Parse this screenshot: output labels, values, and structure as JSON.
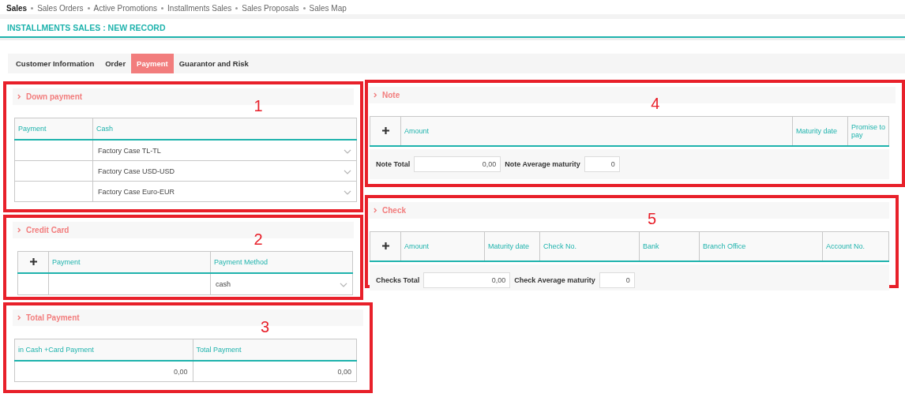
{
  "nav": [
    {
      "label": "Sales",
      "selected": true
    },
    {
      "label": "Sales Orders",
      "selected": false
    },
    {
      "label": "Active Promotions",
      "selected": false
    },
    {
      "label": "Installments Sales",
      "selected": false
    },
    {
      "label": "Sales Proposals",
      "selected": false
    },
    {
      "label": "Sales Map",
      "selected": false
    }
  ],
  "title": "INSTALLMENTS SALES : NEW RECORD",
  "tabs": [
    {
      "label": "Customer Information",
      "selected": false
    },
    {
      "label": "Order",
      "selected": false
    },
    {
      "label": "Payment",
      "selected": true
    },
    {
      "label": "Guarantor and Risk",
      "selected": false
    }
  ],
  "down_payment": {
    "marker": "1",
    "title": "Down payment",
    "columns": [
      "Payment",
      "Cash"
    ],
    "rows": [
      "Factory Case TL-TL",
      "Factory Case USD-USD",
      "Factory Case Euro-EUR"
    ]
  },
  "credit_card": {
    "marker": "2",
    "title": "Credit Card",
    "columns": [
      "Payment",
      "Payment Method"
    ],
    "rows": [
      "cash"
    ]
  },
  "total_payment": {
    "marker": "3",
    "title": "Total Payment",
    "columns": [
      "in Cash +Card Payment",
      "Total Payment"
    ],
    "values": [
      "0,00",
      "0,00"
    ]
  },
  "note": {
    "marker": "4",
    "title": "Note",
    "columns": [
      "Amount",
      "Maturity date",
      "Promise to pay"
    ],
    "totals": [
      {
        "label": "Note Total",
        "value": "0,00"
      },
      {
        "label": "Note Average maturity",
        "value": "0"
      }
    ]
  },
  "check": {
    "marker": "5",
    "title": "Check",
    "columns": [
      "Amount",
      "Maturity date",
      "Check No.",
      "Bank",
      "Branch Office",
      "Account No."
    ],
    "totals": [
      {
        "label": "Checks Total",
        "value": "0,00"
      },
      {
        "label": "Check Average maturity",
        "value": "0"
      }
    ]
  }
}
